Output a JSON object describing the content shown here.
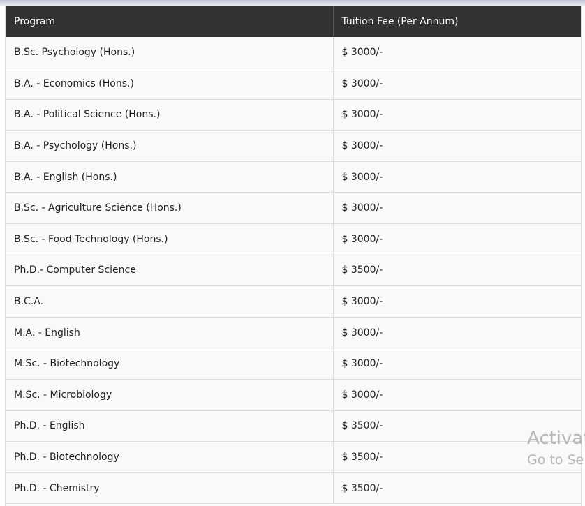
{
  "table": {
    "headers": [
      "Program",
      "Tuition Fee (Per Annum)"
    ],
    "rows": [
      [
        "B.Sc. Psychology (Hons.)",
        "$ 3000/-"
      ],
      [
        "B.A. - Economics (Hons.)",
        "$ 3000/-"
      ],
      [
        "B.A. - Political Science (Hons.)",
        "$ 3000/-"
      ],
      [
        "B.A. - Psychology (Hons.)",
        "$ 3000/-"
      ],
      [
        "B.A. - English (Hons.)",
        "$ 3000/-"
      ],
      [
        "B.Sc. - Agriculture Science (Hons.)",
        "$ 3000/-"
      ],
      [
        "B.Sc. - Food Technology (Hons.)",
        "$ 3000/-"
      ],
      [
        "Ph.D.- Computer Science",
        "$ 3500/-"
      ],
      [
        "B.C.A.",
        "$ 3000/-"
      ],
      [
        "M.A. - English",
        "$ 3000/-"
      ],
      [
        "M.Sc. - Biotechnology",
        "$ 3000/-"
      ],
      [
        "M.Sc. - Microbiology",
        "$ 3000/-"
      ],
      [
        "Ph.D. - English",
        "$ 3500/-"
      ],
      [
        "Ph.D. - Biotechnology",
        "$ 3500/-"
      ],
      [
        "Ph.D. - Chemistry",
        "$ 3500/-"
      ]
    ]
  },
  "watermark": {
    "line1": "Activat",
    "line2": "Go to Se"
  },
  "colors": {
    "header_bg": "#333333",
    "header_text": "#ffffff",
    "row_bg": "#f9f9f9",
    "border": "#dddddd"
  }
}
